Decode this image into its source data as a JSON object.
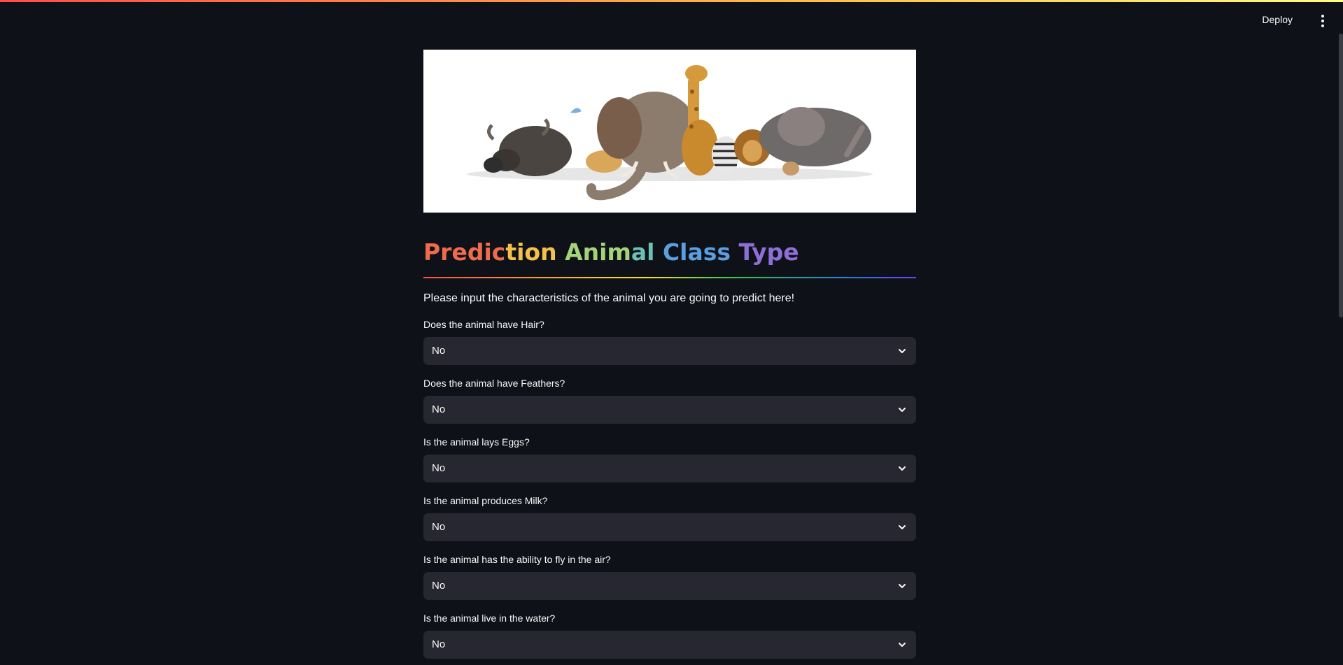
{
  "header": {
    "deploy_label": "Deploy",
    "menu_icon": "vertical-ellipsis-icon"
  },
  "colors": {
    "background": "#0e1117",
    "select_background": "#262730",
    "text": "#fafafa",
    "title_gradient": [
      "#ee6b4d",
      "#f5c04a",
      "#a5d37a",
      "#6cc0b5",
      "#5a9fe0",
      "#8e6fd6"
    ]
  },
  "hero": {
    "image": "safari-animals-banner"
  },
  "title": {
    "part1": "Predic",
    "part2": "tion",
    "part3": "Anim",
    "part4": "al",
    "part5": "Class",
    "part6": "Type"
  },
  "intro": "Please input the characteristics of the animal you are going to predict here!",
  "fields": [
    {
      "label": "Does the animal have Hair?",
      "value": "No"
    },
    {
      "label": "Does the animal have Feathers?",
      "value": "No"
    },
    {
      "label": "Is the animal lays Eggs?",
      "value": "No"
    },
    {
      "label": "Is the animal produces Milk?",
      "value": "No"
    },
    {
      "label": "Is the animal has the ability to fly in the air?",
      "value": "No"
    },
    {
      "label": "Is the animal live in the water?",
      "value": "No"
    }
  ]
}
